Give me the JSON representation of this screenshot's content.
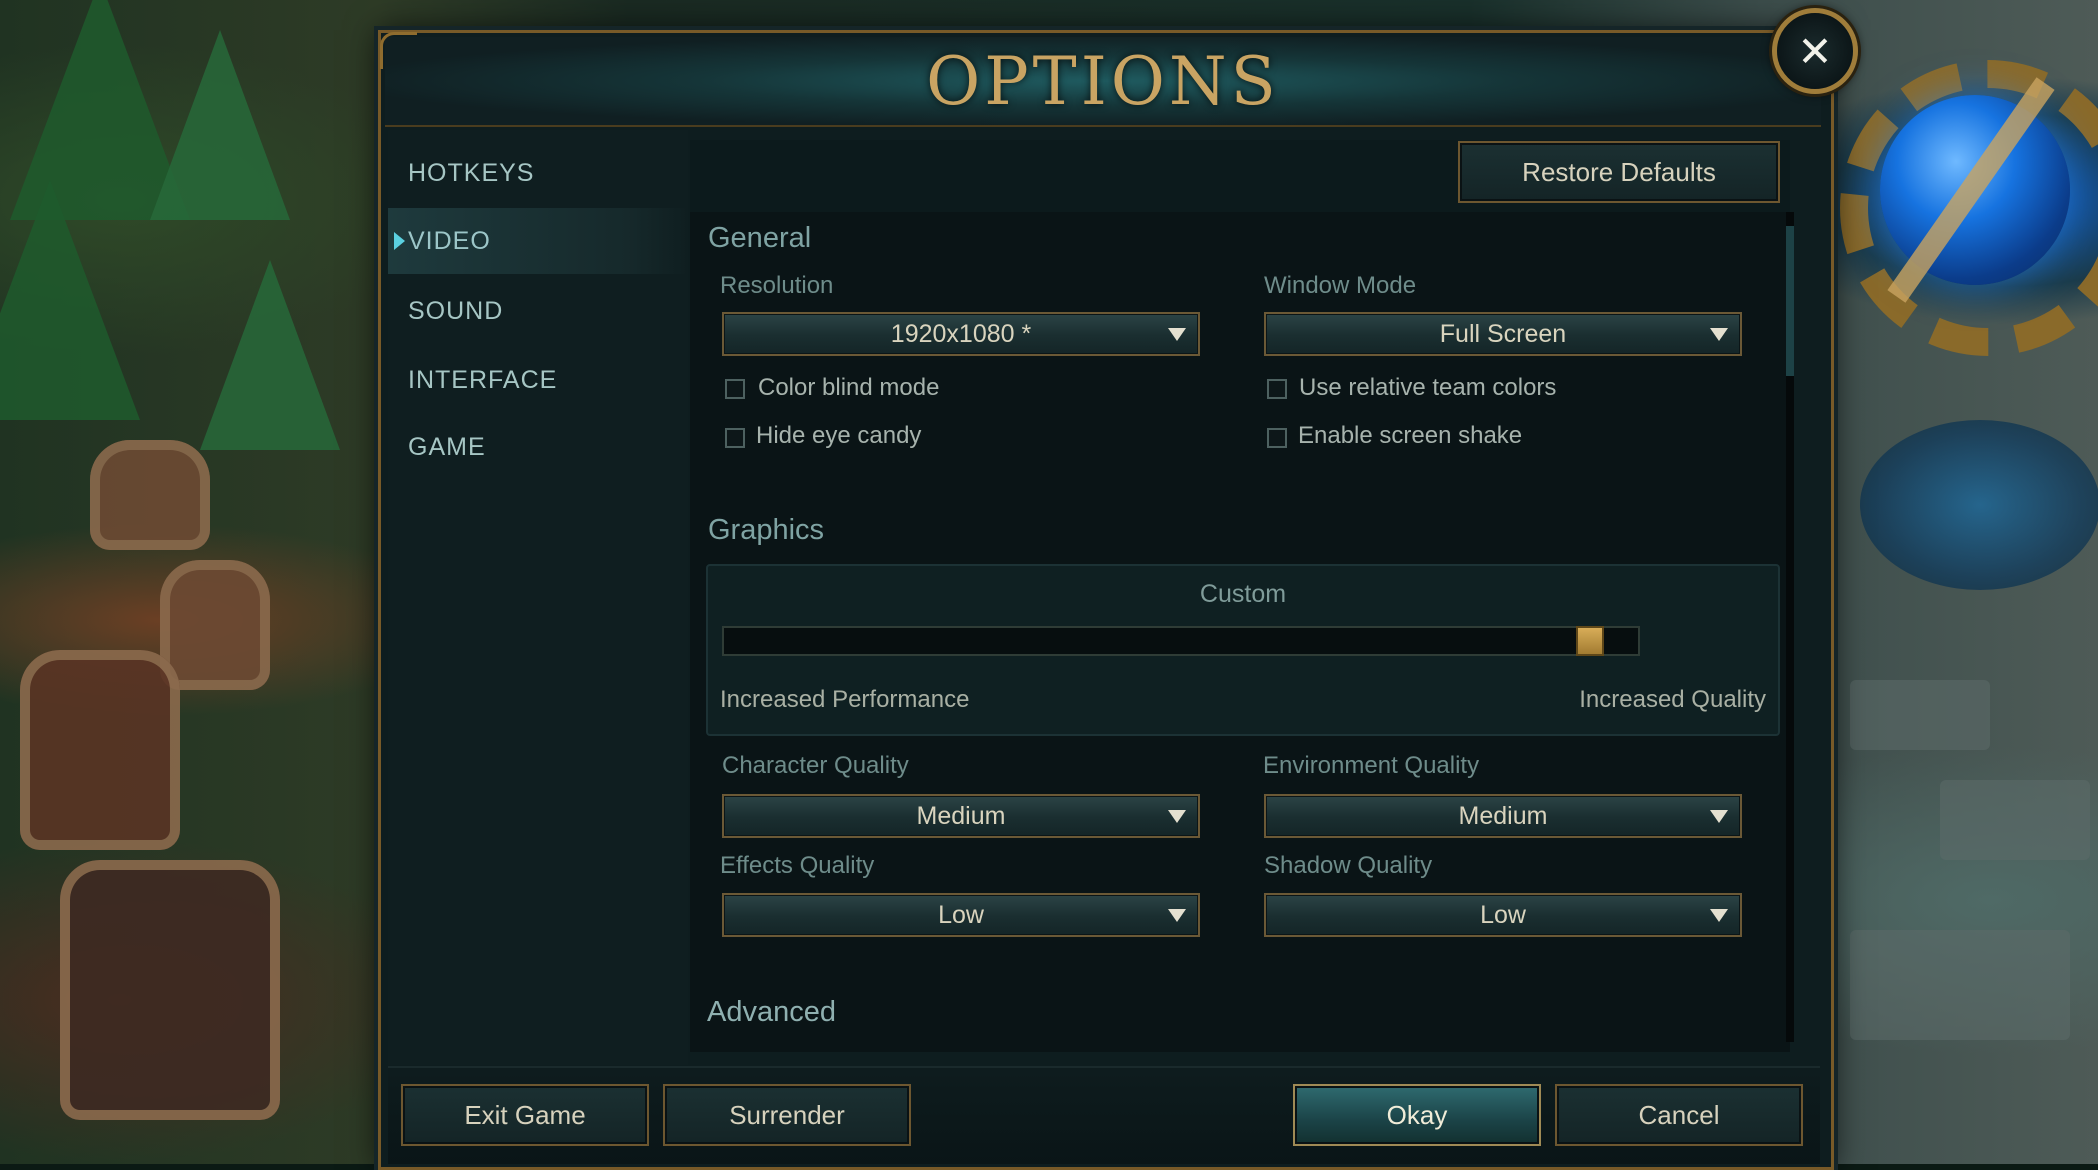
{
  "dialog": {
    "title": "OPTIONS",
    "close_glyph": "✕"
  },
  "sidebar": {
    "items": [
      {
        "label": "HOTKEYS",
        "active": false
      },
      {
        "label": "VIDEO",
        "active": true
      },
      {
        "label": "SOUND",
        "active": false
      },
      {
        "label": "INTERFACE",
        "active": false
      },
      {
        "label": "GAME",
        "active": false
      }
    ]
  },
  "toolbar": {
    "restore_defaults_label": "Restore Defaults"
  },
  "general": {
    "title": "General",
    "resolution": {
      "label": "Resolution",
      "value": "1920x1080 *"
    },
    "window_mode": {
      "label": "Window Mode",
      "value": "Full Screen"
    },
    "checkboxes": {
      "color_blind_mode": {
        "label": "Color blind mode",
        "checked": false
      },
      "hide_eye_candy": {
        "label": "Hide eye candy",
        "checked": false
      },
      "use_relative_team_colors": {
        "label": "Use relative team colors",
        "checked": false
      },
      "enable_screen_shake": {
        "label": "Enable screen shake",
        "checked": false
      }
    }
  },
  "graphics": {
    "title": "Graphics",
    "preset_label": "Custom",
    "slider": {
      "value_fraction": 0.96,
      "min_label": "Increased Performance",
      "max_label": "Increased Quality"
    },
    "character_quality": {
      "label": "Character Quality",
      "value": "Medium"
    },
    "environment_quality": {
      "label": "Environment Quality",
      "value": "Medium"
    },
    "effects_quality": {
      "label": "Effects Quality",
      "value": "Low"
    },
    "shadow_quality": {
      "label": "Shadow Quality",
      "value": "Low"
    }
  },
  "advanced": {
    "title": "Advanced"
  },
  "footer": {
    "exit_game_label": "Exit Game",
    "surrender_label": "Surrender",
    "okay_label": "Okay",
    "cancel_label": "Cancel"
  },
  "colors": {
    "accent_gold": "#c9a463",
    "panel_bg": "#0e1d1f",
    "label_teal": "#7fa3a3",
    "slider_thumb": "#d8ad58"
  }
}
